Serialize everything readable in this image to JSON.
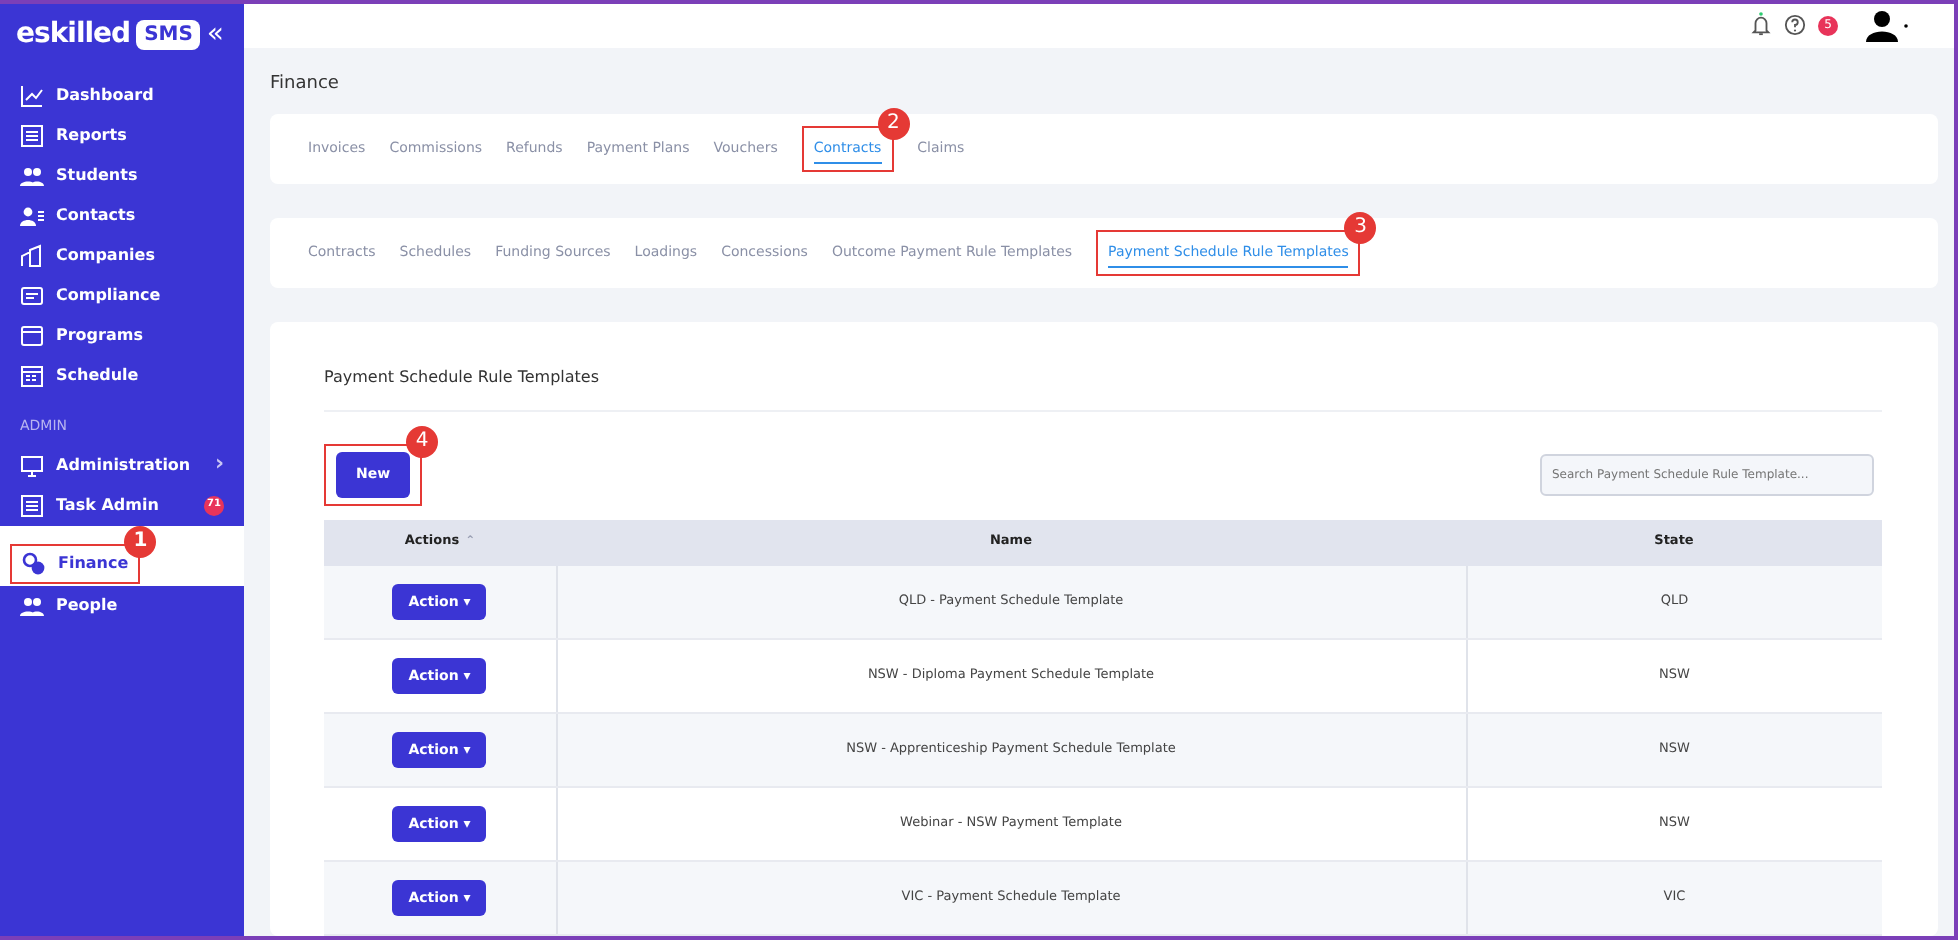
{
  "sidebar": {
    "logo": "eskilled",
    "logo_badge": "SMS",
    "collapse": "«",
    "items": [
      {
        "label": "Dashboard",
        "selected": false
      },
      {
        "label": "Reports",
        "selected": false
      },
      {
        "label": "Students",
        "selected": false
      },
      {
        "label": "Contacts",
        "selected": false
      },
      {
        "label": "Companies",
        "selected": false
      },
      {
        "label": "Compliance",
        "selected": false
      },
      {
        "label": "Programs",
        "selected": false
      },
      {
        "label": "Schedule",
        "selected": false
      }
    ],
    "section": "ADMIN",
    "admin_items": [
      {
        "label": "Administration",
        "selected": false,
        "chevron": "›"
      },
      {
        "label": "Task Admin",
        "selected": false,
        "badge": "71"
      },
      {
        "label": "Finance",
        "selected": true,
        "callout": "1"
      },
      {
        "label": "People",
        "selected": false
      }
    ]
  },
  "topbar": {
    "help_badge": "5"
  },
  "page_title": "Finance",
  "tabs": [
    {
      "label": "Invoices",
      "selected": false
    },
    {
      "label": "Commissions",
      "selected": false
    },
    {
      "label": "Refunds",
      "selected": false
    },
    {
      "label": "Payment Plans",
      "selected": false
    },
    {
      "label": "Vouchers",
      "selected": false
    },
    {
      "label": "Contracts",
      "selected": true,
      "callout": "2"
    },
    {
      "label": "Claims",
      "selected": false
    }
  ],
  "subtabs": [
    {
      "label": "Contracts",
      "selected": false
    },
    {
      "label": "Schedules",
      "selected": false
    },
    {
      "label": "Funding Sources",
      "selected": false
    },
    {
      "label": "Loadings",
      "selected": false
    },
    {
      "label": "Concessions",
      "selected": false
    },
    {
      "label": "Outcome Payment Rule Templates",
      "selected": false
    },
    {
      "label": "Payment Schedule Rule Templates",
      "selected": true,
      "callout": "3"
    }
  ],
  "panel": {
    "title": "Payment Schedule Rule Templates",
    "new_button": {
      "label": "New",
      "callout": "4"
    },
    "search": {
      "placeholder": "Search Payment Schedule Rule Template..."
    },
    "table": {
      "columns": [
        "Actions",
        "Name",
        "State"
      ],
      "sort_indicator": "⌃",
      "rows": [
        {
          "action": "Action ▾",
          "name": "QLD - Payment Schedule Template",
          "state": "QLD"
        },
        {
          "action": "Action ▾",
          "name": "NSW - Diploma Payment Schedule Template",
          "state": "NSW"
        },
        {
          "action": "Action ▾",
          "name": "NSW - Apprenticeship Payment Schedule Template",
          "state": "NSW"
        },
        {
          "action": "Action ▾",
          "name": "Webinar - NSW Payment Template",
          "state": "NSW"
        },
        {
          "action": "Action ▾",
          "name": "VIC - Payment Schedule Template",
          "state": "VIC"
        }
      ]
    }
  }
}
